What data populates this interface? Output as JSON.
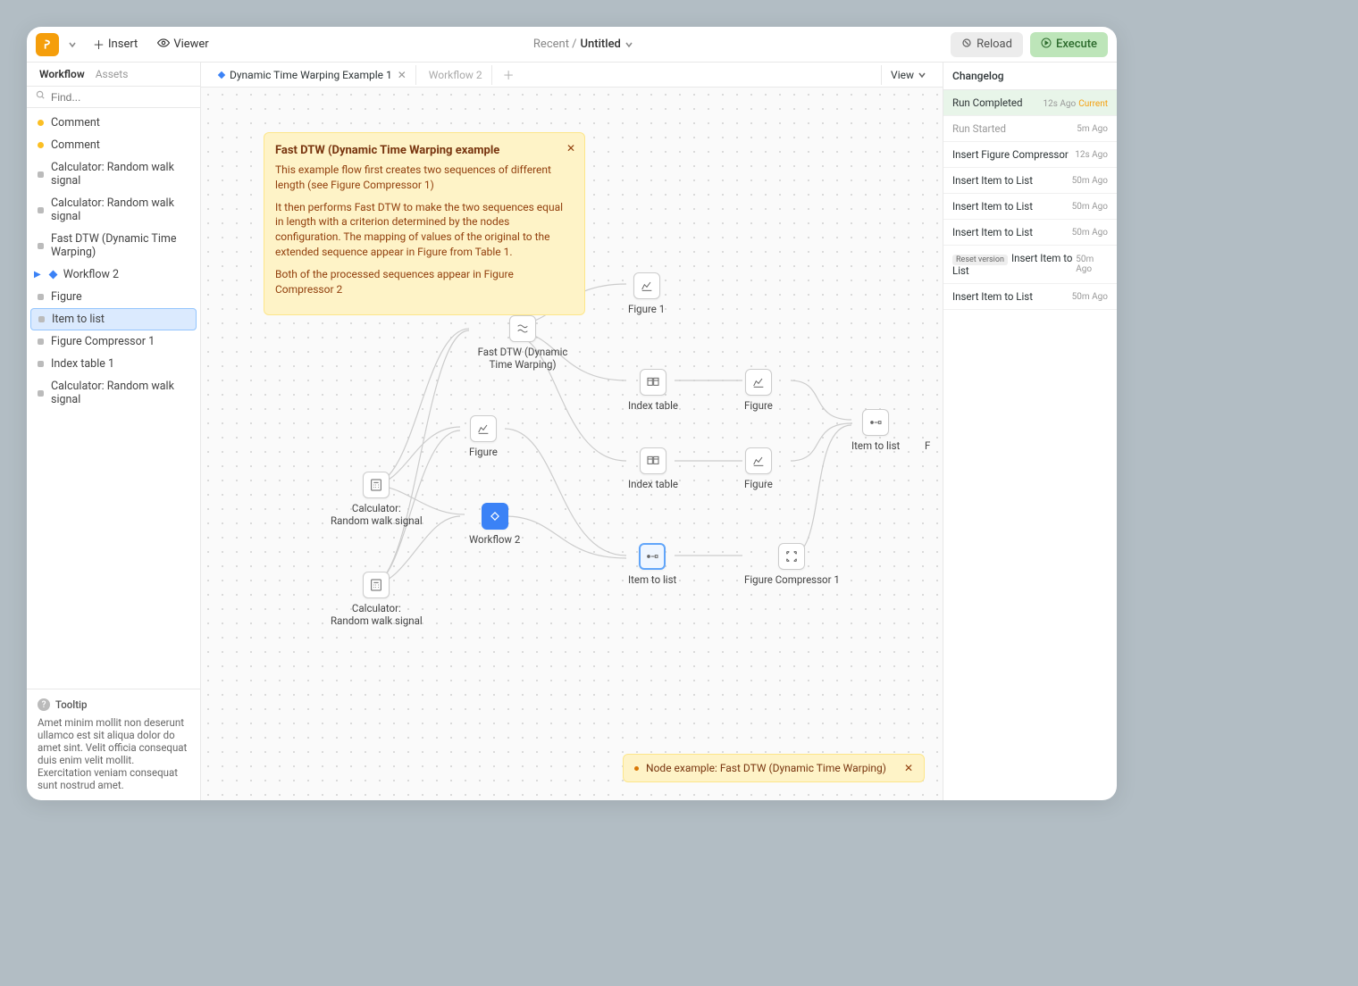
{
  "topbar": {
    "insert": "Insert",
    "viewer": "Viewer",
    "breadcrumb_prefix": "Recent /",
    "title": "Untitled",
    "reload": "Reload",
    "execute": "Execute"
  },
  "sidebar": {
    "tabs": {
      "workflow": "Workflow",
      "assets": "Assets"
    },
    "search_placeholder": "Find...",
    "items": [
      {
        "type": "comment",
        "label": "Comment"
      },
      {
        "type": "comment",
        "label": "Comment"
      },
      {
        "type": "node",
        "label": "Calculator: Random walk signal"
      },
      {
        "type": "node",
        "label": "Calculator: Random walk signal"
      },
      {
        "type": "node",
        "label": "Fast DTW (Dynamic Time Warping)"
      },
      {
        "type": "workflow",
        "label": "Workflow 2"
      },
      {
        "type": "node",
        "label": "Figure"
      },
      {
        "type": "node",
        "label": "Item to list",
        "selected": true
      },
      {
        "type": "node",
        "label": "Figure Compressor 1"
      },
      {
        "type": "node",
        "label": "Index table 1"
      },
      {
        "type": "node",
        "label": "Calculator: Random walk signal"
      }
    ],
    "tooltip": {
      "title": "Tooltip",
      "body": "Amet minim mollit non deserunt ullamco est sit aliqua dolor do amet sint. Velit officia consequat duis enim velit mollit. Exercitation veniam consequat sunt nostrud amet."
    }
  },
  "tabbar": {
    "tab1": "Dynamic Time Warping Example 1",
    "tab2": "Workflow 2",
    "view": "View"
  },
  "infobox": {
    "title": "Fast DTW (Dynamic Time Warping example",
    "p1": "This example flow first creates two sequences of different length (see Figure Compressor 1)",
    "p2": "It then performs Fast DTW to make the two sequences equal in length with a criterion determined by the nodes configuration. The mapping of values of the original to the extended sequence appear in Figure from Table 1.",
    "p3": "Both of the processed sequences appear in Figure Compressor 2"
  },
  "nodes": {
    "calc1": "Calculator:\nRandom walk signal",
    "calc2": "Calculator:\nRandom walk signal",
    "fastdtw": "Fast DTW (Dynamic Time Warping)",
    "figure": "Figure",
    "workflow2": "Workflow 2",
    "figure1": "Figure 1",
    "indextable_a": "Index table",
    "indextable_b": "Index table",
    "figure_a": "Figure",
    "figure_b": "Figure",
    "itemtolist_a": "Item to list",
    "itemtolist_b": "Item to list",
    "figcomp": "Figure Compressor 1",
    "rightcut": "F"
  },
  "toast": {
    "label": "Node example: Fast DTW (Dynamic Time Warping)"
  },
  "changelog": {
    "title": "Changelog",
    "items": [
      {
        "label": "Run Completed",
        "time": "12s Ago",
        "current": true,
        "green": true
      },
      {
        "label": "Run Started",
        "time": "5m Ago"
      },
      {
        "label": "Insert Figure Compressor",
        "time": "12s Ago"
      },
      {
        "label": "Insert Item to List",
        "time": "50m Ago"
      },
      {
        "label": "Insert Item to List",
        "time": "50m Ago"
      },
      {
        "label": "Insert Item to List",
        "time": "50m Ago"
      },
      {
        "label": "Insert Item to List",
        "time": "50m Ago",
        "reset": true
      },
      {
        "label": "Insert Item to List",
        "time": "50m Ago"
      }
    ],
    "reset_badge": "Reset version",
    "current_label": "Current"
  }
}
